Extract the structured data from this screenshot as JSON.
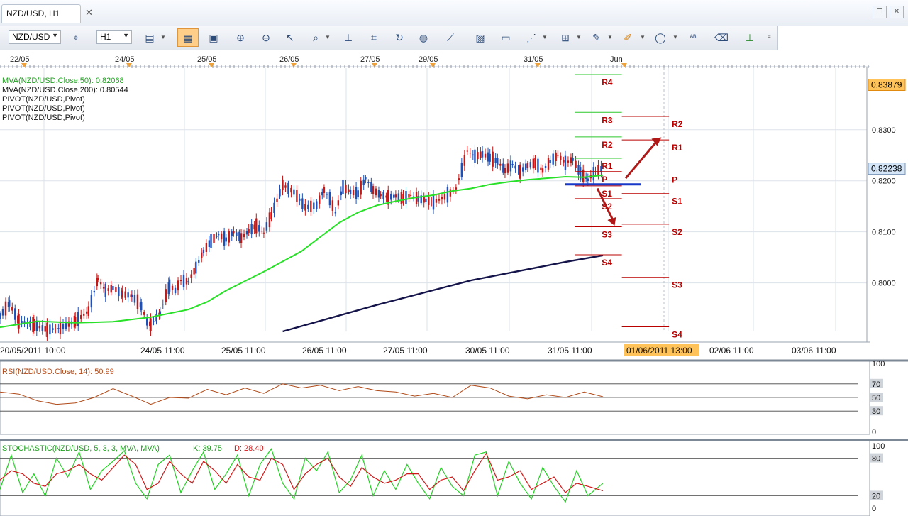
{
  "tab": {
    "title": "NZD/USD, H1",
    "close": "✕"
  },
  "toolbar": {
    "symbol": "NZD/USD",
    "timeframe": "H1",
    "icons": [
      "crosshair-icon",
      "period-icon",
      "chart-type-icon",
      "bar-chart-icon",
      "objects-icon",
      "zoom-in-icon",
      "zoom-out-icon",
      "pointer-icon",
      "search-icon",
      "vertical-line-icon",
      "cursor-icon",
      "refresh-icon",
      "globe-icon",
      "ruler-icon",
      "picture-icon",
      "template-icon",
      "fibonacci-icon",
      "indicator-icon",
      "pencil-icon",
      "highlighter-icon",
      "ellipse-icon",
      "text-icon",
      "eraser-icon",
      "layout-icon"
    ]
  },
  "colors": {
    "grid": "#dde3ea",
    "up_candle": "#1d50b8",
    "down_candle": "#c41818",
    "ma50": "#27e027",
    "ma200": "#14144a",
    "pivot": "#bb0000",
    "rsi": "#b04a18",
    "stoch_k": "#23d023",
    "stoch_d": "#d01818",
    "price_tag": "#ffc35a",
    "current_tag": "#d4e6f8"
  },
  "chart_data": [
    {
      "type": "candlestick",
      "title": "NZD/USD, H1",
      "ylim": [
        0.7905,
        0.8415
      ],
      "y_ticks": [
        "0.8000",
        "0.8100",
        "0.8200",
        "0.8300"
      ],
      "y_tick_values": [
        0.8,
        0.81,
        0.82,
        0.83
      ],
      "price_tags": [
        {
          "label": "0.83879",
          "value": 0.83879,
          "style": "highlight"
        },
        {
          "label": "0.82238",
          "value": 0.82238,
          "style": "current"
        }
      ],
      "x_ticks": [
        "20/05/2011 10:00",
        "24/05 11:00",
        "25/05 11:00",
        "26/05 11:00",
        "27/05 11:00",
        "30/05 11:00",
        "31/05 11:00",
        "01/06/2011 13:00",
        "02/06 11:00",
        "03/06 11:00"
      ],
      "x_highlight": "01/06/2011 13:00",
      "top_dates": [
        "22/05",
        "24/05",
        "25/05",
        "26/05",
        "27/05",
        "29/05",
        "31/05",
        "Jun"
      ],
      "legend": [
        "MVA(NZD/USD.Close,50): 0.82068",
        "MVA(NZD/USD.Close,200): 0.80544",
        "PIVOT(NZD/USD,Pivot)",
        "PIVOT(NZD/USD,Pivot)",
        "PIVOT(NZD/USD,Pivot)"
      ],
      "price_path": {
        "x_index": [
          0,
          5,
          10,
          18,
          25,
          32,
          40,
          47,
          52,
          56,
          60,
          65,
          70,
          75,
          78,
          80,
          85,
          88,
          90,
          93,
          96,
          100,
          104,
          108,
          112,
          116,
          120,
          124,
          128,
          132,
          136,
          140,
          144,
          150,
          156,
          162,
          168,
          172,
          175,
          178,
          182,
          186,
          190,
          194,
          198,
          202,
          206,
          210,
          214,
          218,
          222,
          226,
          230,
          236,
          242,
          248,
          252,
          256,
          260,
          264,
          268,
          272,
          276,
          280,
          284,
          288,
          292,
          296,
          300,
          304,
          308,
          312,
          316,
          320
        ],
        "close": [
          0.7935,
          0.796,
          0.7925,
          0.7918,
          0.7908,
          0.7912,
          0.7925,
          0.7945,
          0.8008,
          0.7985,
          0.799,
          0.7978,
          0.7975,
          0.7955,
          0.7925,
          0.7918,
          0.7942,
          0.7975,
          0.7995,
          0.7985,
          0.8005,
          0.8003,
          0.803,
          0.8062,
          0.8082,
          0.8095,
          0.8085,
          0.81,
          0.8088,
          0.8102,
          0.8112,
          0.8098,
          0.8132,
          0.8192,
          0.8178,
          0.8148,
          0.8152,
          0.8182,
          0.8165,
          0.8138,
          0.8188,
          0.8178,
          0.8175,
          0.8205,
          0.8182,
          0.8172,
          0.8168,
          0.817,
          0.8165,
          0.8172,
          0.8165,
          0.8162,
          0.8158,
          0.8168,
          0.8185,
          0.8258,
          0.8248,
          0.8252,
          0.8245,
          0.8238,
          0.822,
          0.8232,
          0.8218,
          0.823,
          0.8235,
          0.822,
          0.8238,
          0.825,
          0.8235,
          0.8242,
          0.8215,
          0.8202,
          0.8218,
          0.8224
        ]
      },
      "series": [
        {
          "name": "MVA(NZD/USD.Close,50)",
          "x_index": [
            0,
            20,
            40,
            60,
            80,
            100,
            110,
            120,
            140,
            160,
            180,
            190,
            200,
            210,
            220,
            230,
            240,
            250,
            260,
            270,
            280,
            290,
            300,
            310,
            320
          ],
          "values": [
            0.7913,
            0.7925,
            0.7922,
            0.7924,
            0.7933,
            0.7948,
            0.7963,
            0.7985,
            0.8022,
            0.8062,
            0.8118,
            0.8138,
            0.8152,
            0.816,
            0.8167,
            0.8172,
            0.818,
            0.8185,
            0.8193,
            0.8198,
            0.8202,
            0.8205,
            0.8208,
            0.8207,
            0.8211
          ]
        },
        {
          "name": "MVA(NZD/USD.Close,200)",
          "x_index": [
            150,
            200,
            250,
            300,
            320
          ],
          "values": [
            0.7905,
            0.7957,
            0.8005,
            0.8041,
            0.8054
          ]
        }
      ],
      "pivot_sets": [
        {
          "x_range": [
            305,
            330
          ],
          "levels": [
            {
              "label": "R4",
              "value": 0.8408
            },
            {
              "label": "R3",
              "value": 0.8334
            },
            {
              "label": "R2",
              "value": 0.8286
            },
            {
              "label": "R1",
              "value": 0.8244
            },
            {
              "label": "P",
              "value": 0.8218
            },
            {
              "label": "S1",
              "value": 0.819
            },
            {
              "label": "S2",
              "value": 0.8165
            },
            {
              "label": "S3",
              "value": 0.811
            },
            {
              "label": "S4",
              "value": 0.8055
            }
          ]
        },
        {
          "x_range": [
            330,
            355
          ],
          "levels": [
            {
              "label": "R2",
              "value": 0.8326
            },
            {
              "label": "R1",
              "value": 0.828
            },
            {
              "label": "P",
              "value": 0.8217
            },
            {
              "label": "S1",
              "value": 0.8175
            },
            {
              "label": "S2",
              "value": 0.8115
            },
            {
              "label": "S3",
              "value": 0.8011
            },
            {
              "label": "S4",
              "value": 0.7914
            }
          ]
        }
      ],
      "x_index_range": [
        0,
        460
      ]
    },
    {
      "type": "line",
      "title": "RSI(NZD/USD.Close, 14): 50.99",
      "ylim": [
        0,
        100
      ],
      "y_ticks": [
        "100",
        "70",
        "50",
        "30",
        "0"
      ],
      "levels": [
        70,
        50,
        30
      ],
      "series": [
        {
          "name": "RSI(NZD/USD.Close, 14)",
          "x_index": [
            0,
            10,
            20,
            30,
            40,
            50,
            60,
            70,
            80,
            90,
            100,
            110,
            120,
            130,
            140,
            150,
            160,
            170,
            180,
            190,
            200,
            210,
            220,
            230,
            240,
            250,
            260,
            270,
            280,
            290,
            300,
            310,
            320
          ],
          "values": [
            58,
            55,
            45,
            40,
            42,
            50,
            63,
            52,
            40,
            50,
            49,
            62,
            54,
            64,
            56,
            70,
            64,
            68,
            60,
            66,
            60,
            58,
            52,
            56,
            50,
            68,
            64,
            52,
            48,
            54,
            50,
            58,
            51
          ]
        }
      ]
    },
    {
      "type": "line",
      "title": "STOCHASTIC(NZD/USD, 5, 3, 3, MVA, MVA)",
      "k_label": "K: 39.75",
      "d_label": "D: 28.40",
      "ylim": [
        0,
        100
      ],
      "y_ticks": [
        "100",
        "80",
        "20",
        "0"
      ],
      "levels": [
        80,
        20
      ],
      "series": [
        {
          "name": "K",
          "x_index": [
            0,
            6,
            12,
            18,
            24,
            30,
            36,
            42,
            48,
            54,
            60,
            66,
            72,
            78,
            84,
            90,
            96,
            102,
            108,
            114,
            120,
            126,
            132,
            138,
            144,
            150,
            156,
            162,
            168,
            174,
            180,
            186,
            192,
            198,
            204,
            210,
            216,
            222,
            228,
            234,
            240,
            246,
            252,
            258,
            264,
            270,
            276,
            282,
            288,
            294,
            300,
            306,
            312,
            320
          ],
          "values": [
            30,
            85,
            25,
            55,
            20,
            80,
            50,
            90,
            30,
            60,
            75,
            92,
            40,
            15,
            70,
            85,
            25,
            60,
            90,
            30,
            55,
            85,
            20,
            70,
            95,
            40,
            15,
            80,
            60,
            90,
            25,
            45,
            85,
            20,
            60,
            30,
            70,
            40,
            15,
            65,
            35,
            20,
            85,
            90,
            20,
            75,
            40,
            15,
            65,
            35,
            10,
            60,
            20,
            40
          ]
        },
        {
          "name": "D",
          "x_index": [
            0,
            6,
            12,
            18,
            24,
            30,
            36,
            42,
            48,
            54,
            60,
            66,
            72,
            78,
            84,
            90,
            96,
            102,
            108,
            114,
            120,
            126,
            132,
            138,
            144,
            150,
            156,
            162,
            168,
            174,
            180,
            186,
            192,
            198,
            204,
            210,
            216,
            222,
            228,
            234,
            240,
            246,
            252,
            258,
            264,
            270,
            276,
            282,
            288,
            294,
            300,
            306,
            312,
            320
          ],
          "values": [
            45,
            60,
            55,
            40,
            35,
            55,
            60,
            70,
            55,
            45,
            65,
            85,
            70,
            30,
            40,
            75,
            55,
            40,
            75,
            60,
            40,
            70,
            50,
            45,
            80,
            70,
            30,
            55,
            70,
            80,
            50,
            35,
            65,
            50,
            40,
            45,
            55,
            55,
            30,
            45,
            50,
            28,
            60,
            88,
            45,
            50,
            60,
            30,
            40,
            50,
            25,
            40,
            35,
            28
          ]
        }
      ]
    }
  ]
}
